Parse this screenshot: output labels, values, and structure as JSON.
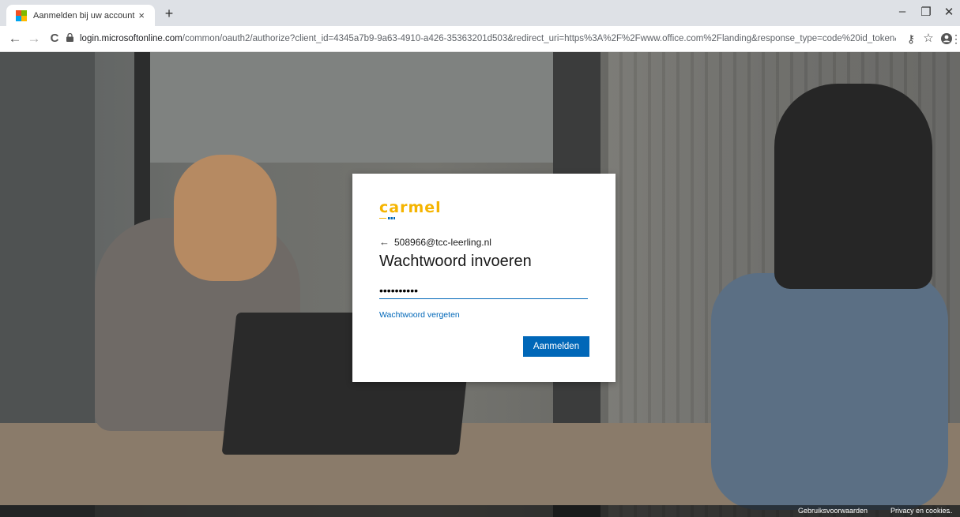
{
  "tab": {
    "title": "Aanmelden bij uw account",
    "close": "×",
    "new_tab": "+"
  },
  "window_controls": {
    "minimize": "–",
    "maximize": "❐",
    "close": "✕"
  },
  "nav": {
    "back": "←",
    "forward": "→",
    "reload": "C"
  },
  "url": {
    "host": "login.microsoftonline.com",
    "rest": "/common/oauth2/authorize?client_id=4345a7b9-9a63-4910-a426-35363201d503&redirect_uri=https%3A%2F%2Fwww.office.com%2Flanding&response_type=code%20id_token&scop..."
  },
  "toolbar_icons": {
    "key": "⚷",
    "star": "☆",
    "account": "●",
    "menu": "⋮"
  },
  "signin": {
    "brand": "carmel",
    "back_arrow": "←",
    "email": "508966@tcc-leerling.nl",
    "heading": "Wachtwoord invoeren",
    "password_value": "••••••••••",
    "forgot": "Wachtwoord vergeten",
    "button": "Aanmelden"
  },
  "footer": {
    "terms": "Gebruiksvoorwaarden",
    "privacy": "Privacy en cookies",
    "more": "..."
  },
  "colors": {
    "accent": "#0067b8",
    "brand": "#f5b400"
  }
}
